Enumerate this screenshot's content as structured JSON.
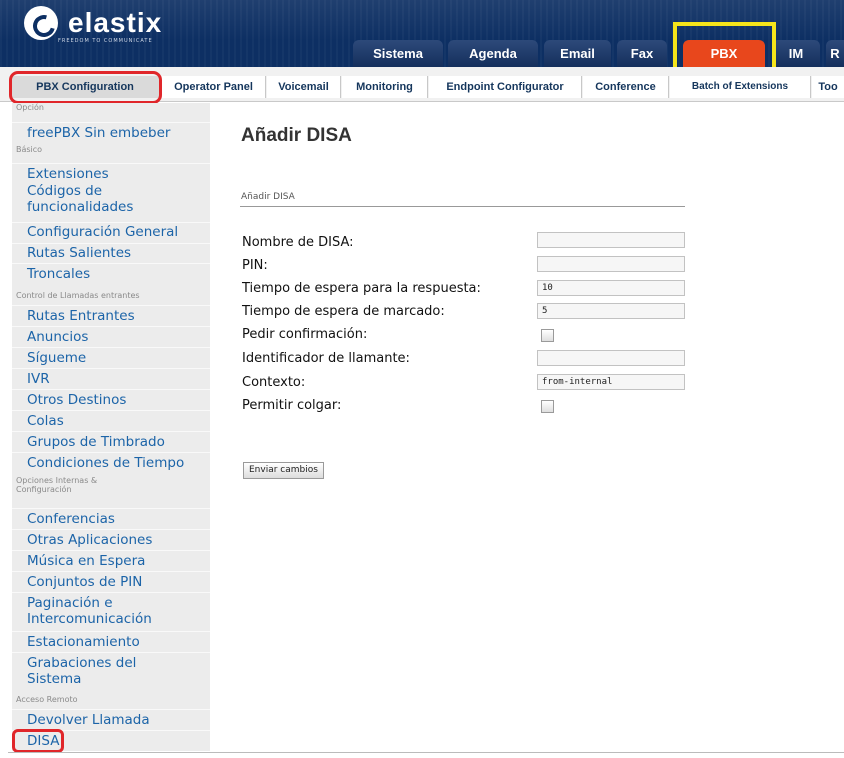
{
  "header": {
    "logo_text": "elastix",
    "logo_tagline": "FREEDOM TO COMMUNICATE",
    "tabs": [
      {
        "label": "Sistema"
      },
      {
        "label": "Agenda"
      },
      {
        "label": "Email"
      },
      {
        "label": "Fax"
      },
      {
        "label": "PBX",
        "active": true
      },
      {
        "label": "IM"
      },
      {
        "label": "R"
      }
    ]
  },
  "submenu": {
    "tabs": [
      {
        "label": "PBX Configuration",
        "active": true
      },
      {
        "label": "Operator Panel"
      },
      {
        "label": "Voicemail"
      },
      {
        "label": "Monitoring"
      },
      {
        "label": "Endpoint Configurator"
      },
      {
        "label": "Conference"
      },
      {
        "label": "Batch of Extensions"
      },
      {
        "label": "Too"
      }
    ]
  },
  "sidebar": {
    "top_cut": "Opción",
    "first": "freePBX Sin embeber",
    "sections": [
      {
        "title": "Básico",
        "items": [
          "Extensiones",
          "Códigos de funcionalidades",
          "Configuración General",
          "Rutas Salientes",
          "Troncales"
        ]
      },
      {
        "title": "Control de Llamadas entrantes",
        "items": [
          "Rutas Entrantes",
          "Anuncios",
          "Sígueme",
          "IVR",
          "Otros Destinos",
          "Colas",
          "Grupos de Timbrado",
          "Condiciones de Tiempo"
        ]
      },
      {
        "title": "Opciones Internas & Configuración",
        "items": [
          "Conferencias",
          "Otras Aplicaciones",
          "Música en Espera",
          "Conjuntos de PIN",
          "Paginación e Intercomunicación",
          "Estacionamiento",
          "Grabaciones del Sistema"
        ]
      },
      {
        "title": "Acceso Remoto",
        "items": [
          "Devolver Llamada",
          "DISA"
        ]
      }
    ]
  },
  "main": {
    "title": "Añadir DISA",
    "section_label": "Añadir DISA",
    "fields": {
      "nombre": {
        "label": "Nombre de DISA:",
        "value": ""
      },
      "pin": {
        "label": "PIN:",
        "value": ""
      },
      "respuesta": {
        "label": "Tiempo de espera para la respuesta:",
        "value": "10"
      },
      "marcado": {
        "label": "Tiempo de espera de marcado:",
        "value": "5"
      },
      "confirmacion": {
        "label": "Pedir confirmación:",
        "checked": false
      },
      "identificador": {
        "label": "Identificador de llamante:",
        "value": ""
      },
      "contexto": {
        "label": "Contexto:",
        "value": "from-internal"
      },
      "colgar": {
        "label": "Permitir colgar:",
        "checked": false
      }
    },
    "submit_label": "Enviar cambios"
  },
  "colors": {
    "header_bg": "#0d2f63",
    "active_tab": "#e8471c",
    "link": "#1c64a8",
    "highlight_red": "#e0262a",
    "highlight_yellow": "#f5e51b"
  }
}
